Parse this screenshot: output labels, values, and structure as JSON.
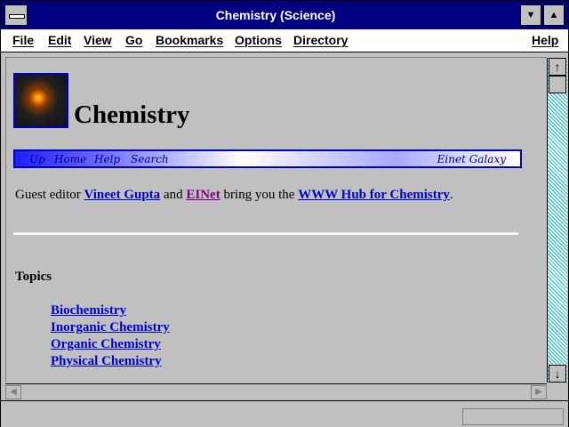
{
  "window": {
    "title": "Chemistry (Science)"
  },
  "menubar": [
    "File",
    "Edit",
    "View",
    "Go",
    "Bookmarks",
    "Options",
    "Directory",
    "Help"
  ],
  "page": {
    "heading": "Chemistry",
    "navbar": [
      "Up",
      "Home",
      "Help",
      "Search"
    ],
    "galaxy": "Einet Galaxy",
    "intro": {
      "prefix": "Guest editor ",
      "editor": "Vineet Gupta",
      "and": " and ",
      "org": "EINet",
      "middle": " bring you the ",
      "hub": "WWW Hub for Chemistry",
      "end": "."
    },
    "topics_title": "Topics",
    "topics": [
      "Biochemistry",
      "Inorganic Chemistry",
      "Organic Chemistry",
      "Physical Chemistry"
    ]
  },
  "icons": [
    "system-menu-icon",
    "minimize-icon",
    "maximize-icon",
    "scroll-up-icon",
    "scroll-down-icon",
    "scroll-left-icon",
    "scroll-right-icon"
  ]
}
